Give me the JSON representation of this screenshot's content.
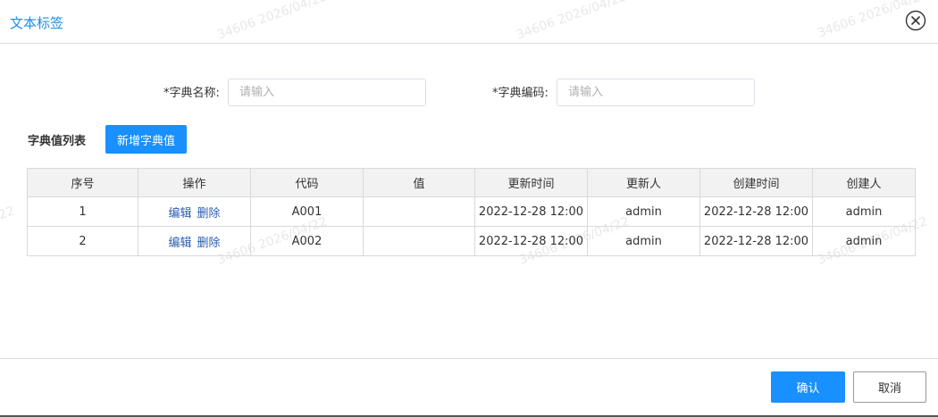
{
  "dialog": {
    "title": "文本标签",
    "close_icon": "close-circle-icon"
  },
  "watermark": "34606 2026/04/22",
  "form": {
    "dict_name": {
      "label": "*字典名称:",
      "value": "",
      "placeholder": "请输入"
    },
    "dict_code": {
      "label": "*字典编码:",
      "value": "",
      "placeholder": "请输入"
    }
  },
  "list": {
    "label": "字典值列表",
    "add_button": "新增字典值"
  },
  "table": {
    "headers": [
      "序号",
      "操作",
      "代码",
      "值",
      "更新时间",
      "更新人",
      "创建时间",
      "创建人"
    ],
    "rows": [
      {
        "seq": "1",
        "edit": "编辑",
        "delete": "删除",
        "code": "A001",
        "value": "",
        "updated_at": "2022-12-28 12:00",
        "updated_by": "admin",
        "created_at": "2022-12-28 12:00",
        "created_by": "admin"
      },
      {
        "seq": "2",
        "edit": "编辑",
        "delete": "删除",
        "code": "A002",
        "value": "",
        "updated_at": "2022-12-28 12:00",
        "updated_by": "admin",
        "created_at": "2022-12-28 12:00",
        "created_by": "admin"
      }
    ]
  },
  "footer": {
    "ok_label": "确认",
    "cancel_label": "取消"
  },
  "colors": {
    "primary": "#1890ff",
    "title": "#1a8ee6",
    "link": "#2a5db0"
  }
}
